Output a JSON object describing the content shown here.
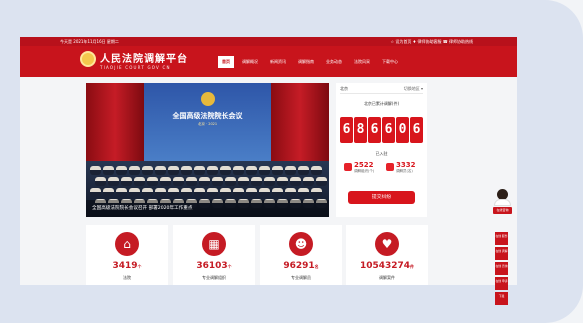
{
  "topbar": {
    "left_text": "今天是 2021年11月16日 星期二",
    "right_text": "☆ 设为首页    ♦ 律师协助客服    ☎ 律师协助热线"
  },
  "header": {
    "site_title": "人民法院调解平台",
    "site_subtitle": "TIAOJIE COURT GOV CN"
  },
  "nav": [
    {
      "label": "首页",
      "active": true
    },
    {
      "label": "调解概况",
      "active": false
    },
    {
      "label": "新闻资讯",
      "active": false
    },
    {
      "label": "调解指南",
      "active": false
    },
    {
      "label": "业务动态",
      "active": false
    },
    {
      "label": "法院风采",
      "active": false
    },
    {
      "label": "下载中心",
      "active": false
    }
  ],
  "hero": {
    "banner_title": "全国高级法院院长会议",
    "banner_subtitle": "北京 · 2021",
    "caption": "全国高级法院院长会议召开 部署2020年工作重点"
  },
  "counter": {
    "location": "北京",
    "switch": "切换地区 ▾",
    "title": "北京已累计调解(件)",
    "digits": [
      "6",
      "8",
      "6",
      "6",
      "0",
      "6"
    ],
    "joined_title": "已入驻",
    "courts_value": "2522",
    "courts_label": "调解组织(个)",
    "mediators_value": "3332",
    "mediators_label": "调解员(名)",
    "submit_label": "提交纠纷"
  },
  "stats": [
    {
      "value": "3419",
      "unit": "个",
      "label": "法院",
      "icon": "court-icon"
    },
    {
      "value": "36103",
      "unit": "个",
      "label": "专业调解组织",
      "icon": "building-icon"
    },
    {
      "value": "96291",
      "unit": "名",
      "label": "专业调解员",
      "icon": "people-icon"
    },
    {
      "value": "10543274",
      "unit": "件",
      "label": "调解案件",
      "icon": "handshake-icon"
    }
  ],
  "side": {
    "avatar_label": "在线咨询",
    "items": [
      "在线\n服务",
      "在线\n调解",
      "在线\n咨询",
      "在线\n申诉",
      "下载"
    ]
  }
}
